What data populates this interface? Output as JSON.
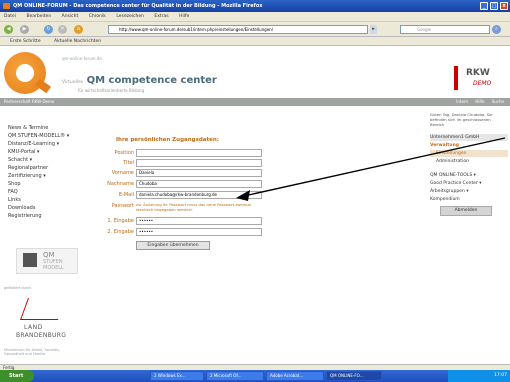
{
  "window": {
    "title": "QM ONLINE-FORUM - Das competence center für Qualität in der Bildung - Mozilla Firefox",
    "buttons": [
      "_",
      "□",
      "x"
    ]
  },
  "menubar": [
    "Datei",
    "Bearbeiten",
    "Ansicht",
    "Chronik",
    "Lesezeichen",
    "Extras",
    "Hilfe"
  ],
  "navbar": {
    "url": "http://www.qm-online-forum.de/sub1/intern.php/einstellungen/Einstellungen/",
    "search_placeholder": "Google"
  },
  "bookmarks": [
    "Erste Schritte",
    "Aktuelle Nachrichten"
  ],
  "header": {
    "site_lines": [
      "qm-online-forum.de",
      "Virtuelles"
    ],
    "title": "QM competence center",
    "title_prefix": "Virtuelles",
    "subtitle": "für wirtschaftsorientierte Bildung",
    "rkw": "RKW",
    "demo": "DEMO"
  },
  "graybar": {
    "left": "Partnerschaft RKW-Demo",
    "links": [
      "Intern",
      "Hilfe",
      "Suche"
    ]
  },
  "leftnav": [
    "News & Termine",
    "QM STUFEN-MODELL® ▾",
    "Distanz/E-Learning ▾",
    "KMU-Portal ▾",
    "Schacht ▾",
    "Regionalpartner",
    "Zertifizierung ▾",
    "Shop",
    "FAQ",
    "Links",
    "Downloads",
    "Registrierung"
  ],
  "qm_logo": {
    "l1": "QM",
    "l2": "STUFEN",
    "l3": "MODELL"
  },
  "gefoerdert": "gefördert durch",
  "land_logo": {
    "l1": "LAND",
    "l2": "BRANDENBURG"
  },
  "land_small": "Ministerium für Arbeit, Soziales, Gesundheit und Familie",
  "form": {
    "title": "Ihre persönlichen Zugangsdaten:",
    "fields": [
      {
        "label": "Position",
        "value": ""
      },
      {
        "label": "Titel",
        "value": ""
      },
      {
        "label": "Vorname",
        "value": "Daniela"
      },
      {
        "label": "Nachname",
        "value": "Chudoba"
      },
      {
        "label": "E-Mail",
        "value": "daniela.chudoba@rkw-brandenburg.de"
      }
    ],
    "password_label": "Passwort",
    "password_text": "zur Änderung Ihr Passwort muss das neue Passwort zweimal identisch angegeben werden!",
    "pw1_label": "1. Eingabe",
    "pw1_value": "••••••",
    "pw2_label": "2. Eingabe",
    "pw2_value": "••••••",
    "submit": "Eingaben übernehmen"
  },
  "rightpanel": {
    "user": "Guten Tag, Daniela Chudoba, Sie befinden sich im geschlossenen Bereich",
    "company": "Unternehmen1 GmbH",
    "section": "Verwaltung",
    "items": [
      "Einstellungen",
      "Administration"
    ],
    "groups": [
      "QM ONLINE-TOOLS ▾",
      "Good Practice Center ▾",
      "Arbeitsgruppen ▾",
      "Kompendium"
    ],
    "logout": "Abmelden"
  },
  "statusbar": "Fertig",
  "taskbar": {
    "start": "Start",
    "items": [
      "2 Windows Ex...",
      "2 Microsoft Of...",
      "Adobe Acrobat...",
      "QM ONLINE-FO...",
      ""
    ],
    "time": "17:07"
  },
  "colors": {
    "accent": "#c06a14",
    "brand_orange": "#e57f1c",
    "rkw_red": "#cc0000"
  }
}
